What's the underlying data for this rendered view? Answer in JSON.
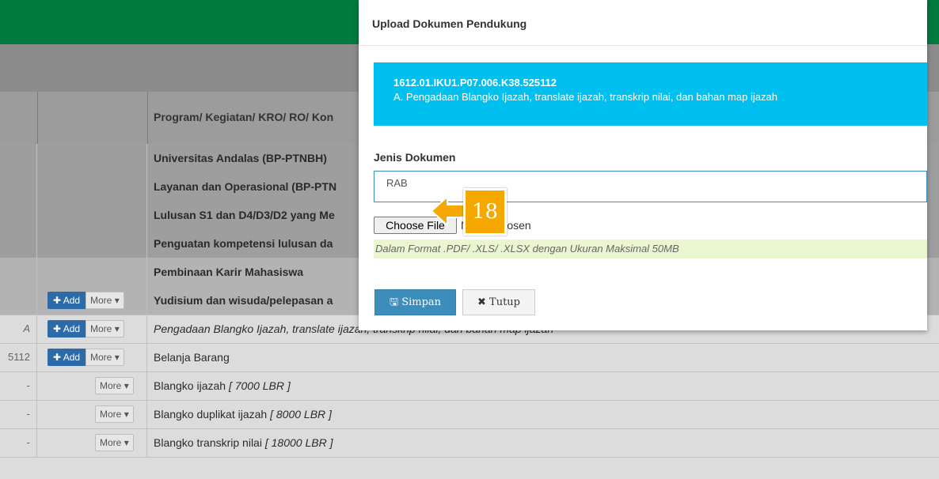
{
  "table": {
    "header_label": "Program/ Kegiatan/ KRO/ RO/ Kon",
    "rows": [
      {
        "col_a": "",
        "col_c": "Universitas Andalas (BP-PTNBH)"
      },
      {
        "col_a": "",
        "col_c": "Layanan dan Operasional (BP-PTN"
      },
      {
        "col_a": "",
        "col_c": "Lulusan S1 dan D4/D3/D2 yang Me"
      },
      {
        "col_a": "",
        "col_c": "Penguatan kompetensi lulusan da"
      },
      {
        "col_a": "",
        "col_c": "Pembinaan Karir Mahasiswa"
      },
      {
        "col_a": "",
        "col_c": "Yudisium dan wisuda/pelepasan a"
      },
      {
        "col_a": "A",
        "col_c": "Pengadaan Blangko Ijazah, translate ijazah, transkrip nilai, dan bahan map ijazah"
      },
      {
        "col_a": "5112",
        "col_c": "Belanja Barang"
      },
      {
        "col_a": "-",
        "col_c": "Blangko ijazah",
        "col_c_qty": "[ 7000 LBR ]"
      },
      {
        "col_a": "-",
        "col_c": "Blangko duplikat ijazah",
        "col_c_qty": "[ 8000 LBR ]"
      },
      {
        "col_a": "-",
        "col_c": "Blangko transkrip nilai",
        "col_c_qty": "[ 18000 LBR ]"
      }
    ],
    "add_label": "Add",
    "more_label": "More"
  },
  "modal": {
    "title": "Upload Dokumen Pendukung",
    "info_code": "1612.01.IKU1.P07.006.K38.525112",
    "info_text": "A. Pengadaan Blangko Ijazah, translate ijazah, transkrip nilai, dan bahan map ijazah",
    "field_label": "Jenis Dokumen",
    "select_value": "RAB",
    "choose_file_label": "Choose File",
    "no_file_text": "No file chosen",
    "hint": "Dalam Format .PDF/ .XLS/ .XLSX dengan Ukuran Maksimal 50MB",
    "save_label": "Simpan",
    "close_label": "Tutup"
  },
  "callout": {
    "number": "18",
    "color": "#f5a800"
  },
  "colors": {
    "header_green": "#007a3d",
    "info_cyan": "#00c0ef",
    "primary_blue": "#3c8dbc"
  }
}
